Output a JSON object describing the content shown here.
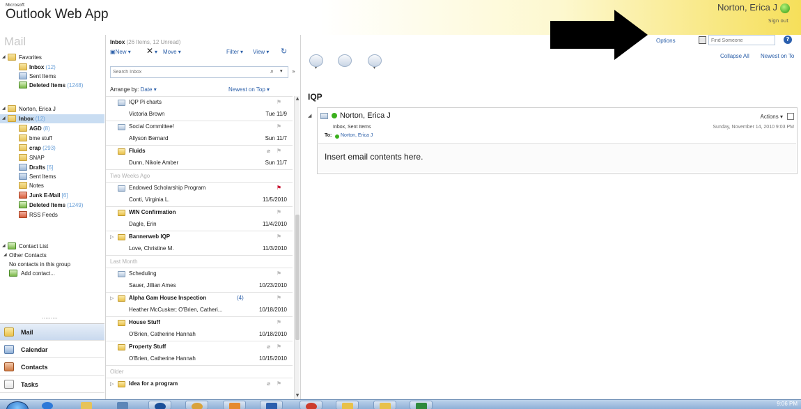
{
  "header": {
    "brand_small": "Microsoft",
    "brand": "Outlook Web App",
    "user_name": "Norton, Erica J",
    "sign_out": "Sign out",
    "options": "Options",
    "find_placeholder": "Find Someone",
    "help": "?"
  },
  "nav": {
    "title": "Mail",
    "favorites_label": "Favorites",
    "favorites": [
      {
        "label": "Inbox",
        "count": "(12)",
        "bold": true
      },
      {
        "label": "Sent Items",
        "count": ""
      },
      {
        "label": "Deleted Items",
        "count": "(1248)",
        "bold": true
      }
    ],
    "mailbox_label": "Norton, Erica J",
    "folders": [
      {
        "label": "Inbox",
        "count": "(12)",
        "bold": true,
        "selected": true
      },
      {
        "label": "AGD",
        "count": "(8)",
        "bold": true
      },
      {
        "label": "bme stuff",
        "count": ""
      },
      {
        "label": "crap",
        "count": "(293)",
        "bold": true
      },
      {
        "label": "SNAP",
        "count": ""
      },
      {
        "label": "Drafts",
        "count": "[6]",
        "bold": true
      },
      {
        "label": "Sent Items",
        "count": ""
      },
      {
        "label": "Notes",
        "count": ""
      },
      {
        "label": "Junk E-Mail",
        "count": "[6]",
        "bold": true
      },
      {
        "label": "Deleted Items",
        "count": "(1249)",
        "bold": true
      },
      {
        "label": "RSS Feeds",
        "count": ""
      }
    ],
    "contact_list": "Contact List",
    "other_contacts": "Other Contacts",
    "no_contacts": "No contacts in this group",
    "add_contact": "Add contact...",
    "dots": "........."
  },
  "nav_bottom": {
    "mail": "Mail",
    "calendar": "Calendar",
    "contacts": "Contacts",
    "tasks": "Tasks"
  },
  "list": {
    "folder_name": "Inbox",
    "folder_stats": "(26 Items, 12 Unread)",
    "new": "New",
    "move": "Move",
    "filter": "Filter",
    "view": "View",
    "search_placeholder": "Search Inbox",
    "arrange_label": "Arrange by:",
    "arrange_value": "Date",
    "newest_on_top": "Newest on Top",
    "sections": {
      "two_weeks": "Two Weeks Ago",
      "last_month": "Last Month",
      "older": "Older"
    },
    "messages": [
      {
        "subject": "IQP Pi charts",
        "from": "Victoria Brown",
        "date": "Tue 11/9",
        "unread": false
      },
      {
        "subject": "Social Committee!",
        "from": "Allyson Bernard",
        "date": "Sun 11/7",
        "unread": false
      },
      {
        "subject": "Fluids",
        "from": "Dunn, Nikole Amber",
        "date": "Sun 11/7",
        "unread": true,
        "attach": true
      },
      {
        "subject": "Endowed Scholarship Program",
        "from": "Conti, Virginia L.",
        "date": "11/5/2010",
        "unread": false,
        "flag_red": true
      },
      {
        "subject": "WIN Confirmation",
        "from": "Dagle, Erin",
        "date": "11/4/2010",
        "unread": true
      },
      {
        "subject": "Bannerweb IQP",
        "from": "Love, Christine M.",
        "date": "11/3/2010",
        "unread": true,
        "thread": true
      },
      {
        "subject": "Scheduling",
        "from": "Sauer, Jillian Ames",
        "date": "10/23/2010",
        "unread": false
      },
      {
        "subject": "Alpha Gam House Inspection",
        "from": "Heather McCusker; O'Brien, Catheri...",
        "date": "10/18/2010",
        "unread": true,
        "thread": true,
        "count": "(4)"
      },
      {
        "subject": "House Stuff",
        "from": "O'Brien, Catherine Hannah",
        "date": "10/18/2010",
        "unread": true
      },
      {
        "subject": "Property Stuff",
        "from": "O'Brien, Catherine Hannah",
        "date": "10/15/2010",
        "unread": true,
        "attach": true
      },
      {
        "subject": "Idea for a program",
        "from": "",
        "date": "",
        "unread": true,
        "attach": true
      }
    ]
  },
  "reading": {
    "collapse_all": "Collapse All",
    "newest_on_top": "Newest on To",
    "conversation_title": "IQP",
    "sender": "Norton, Erica J",
    "folders": "Inbox, Sent Items",
    "to_label": "To:",
    "recipient": "Norton, Erica J",
    "actions": "Actions",
    "date": "Sunday, November 14, 2010 9:03 PM",
    "body": "Insert email contents here."
  },
  "taskbar": {
    "time": "9:06 PM"
  },
  "colors": {
    "accent_blue": "#2a5ea8",
    "header_yellow": "#f6df5a",
    "presence_green": "#3bb01d",
    "flag_red": "#c8102e"
  }
}
